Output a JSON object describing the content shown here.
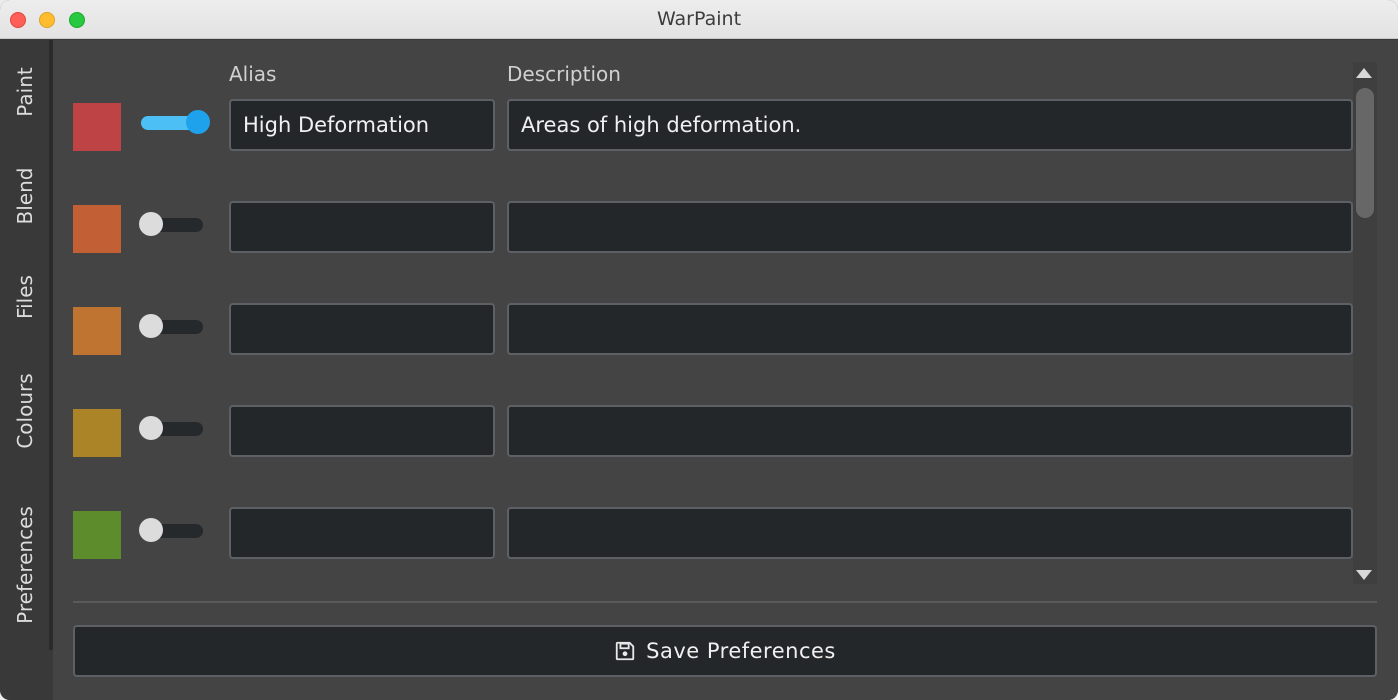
{
  "window": {
    "title": "WarPaint"
  },
  "sidebar": {
    "tabs": [
      {
        "label": "Paint",
        "active": false
      },
      {
        "label": "Blend",
        "active": false
      },
      {
        "label": "Files",
        "active": false
      },
      {
        "label": "Colours",
        "active": true
      },
      {
        "label": "Preferences",
        "active": false
      }
    ]
  },
  "colours": {
    "alias_header": "Alias",
    "description_header": "Description",
    "rows": [
      {
        "color": "#bd4345",
        "enabled": true,
        "alias": "High Deformation",
        "description": "Areas of high deformation."
      },
      {
        "color": "#c35f35",
        "enabled": false,
        "alias": "",
        "description": ""
      },
      {
        "color": "#bf7432",
        "enabled": false,
        "alias": "",
        "description": ""
      },
      {
        "color": "#ab8428",
        "enabled": false,
        "alias": "",
        "description": ""
      },
      {
        "color": "#5c8c2c",
        "enabled": false,
        "alias": "",
        "description": ""
      }
    ]
  },
  "footer": {
    "save_label": "Save Preferences",
    "save_icon": "floppy-disk-icon"
  }
}
